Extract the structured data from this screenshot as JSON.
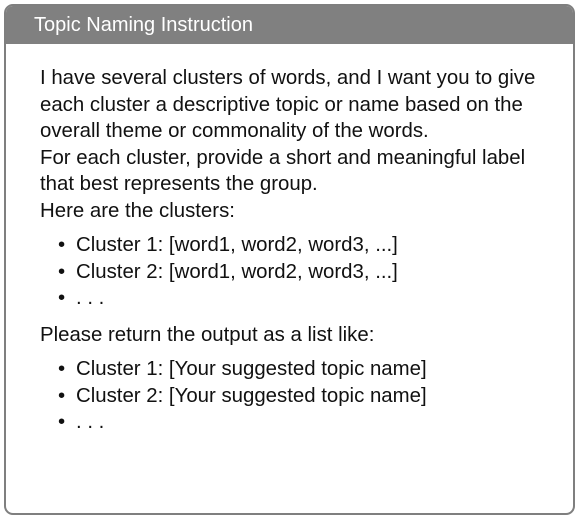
{
  "header": {
    "title": "Topic Naming Instruction"
  },
  "content": {
    "intro_lines": [
      "I have several clusters of words, and I want you to give each cluster a descriptive topic or name based on the overall theme or commonality of the words.",
      "For each cluster, provide a short and meaningful label that best represents the group.",
      "Here are the clusters:"
    ],
    "clusters_list": [
      "Cluster 1: [word1, word2, word3, ...]",
      "Cluster 2: [word1, word2, word3, ...]",
      ". . ."
    ],
    "output_prompt": "Please return the output as a list like:",
    "output_list": [
      "Cluster 1: [Your suggested topic name]",
      "Cluster 2: [Your suggested topic name]",
      ". . ."
    ],
    "bullet": "•"
  }
}
